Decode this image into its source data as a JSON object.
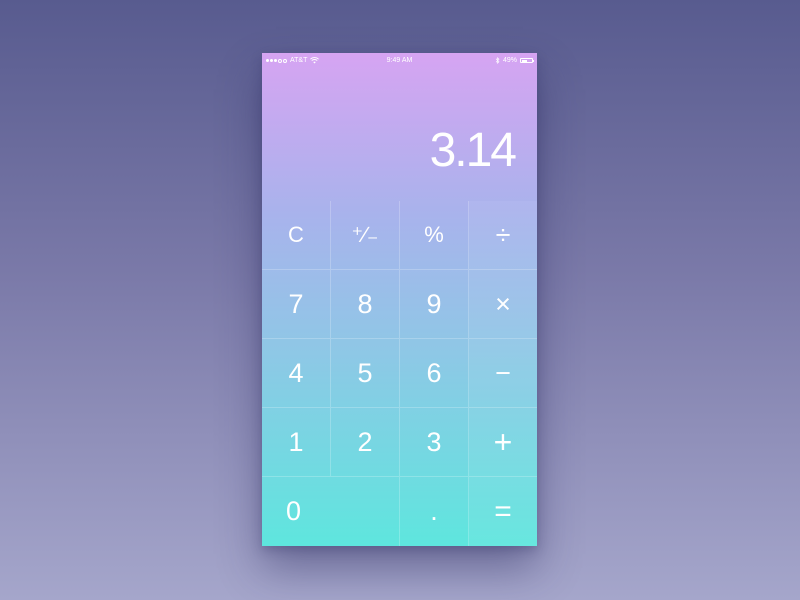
{
  "status_bar": {
    "carrier": "AT&T",
    "time": "9:49 AM",
    "battery": "49%",
    "battery_level": 0.49,
    "signal_bars_filled": 3,
    "signal_bars_total": 5
  },
  "display": {
    "value": "3.14"
  },
  "keys": {
    "clear": "C",
    "plus_minus": "⁺∕₋",
    "percent": "%",
    "divide": "÷",
    "seven": "7",
    "eight": "8",
    "nine": "9",
    "multiply": "×",
    "four": "4",
    "five": "5",
    "six": "6",
    "minus": "−",
    "one": "1",
    "two": "2",
    "three": "3",
    "plus": "+",
    "zero": "0",
    "decimal": ".",
    "equals": "="
  },
  "colors": {
    "background_top": "#585b8f",
    "background_bottom": "#a5a6cb",
    "phone_top": "#d6a4f2",
    "phone_bottom": "#5ee6de"
  }
}
